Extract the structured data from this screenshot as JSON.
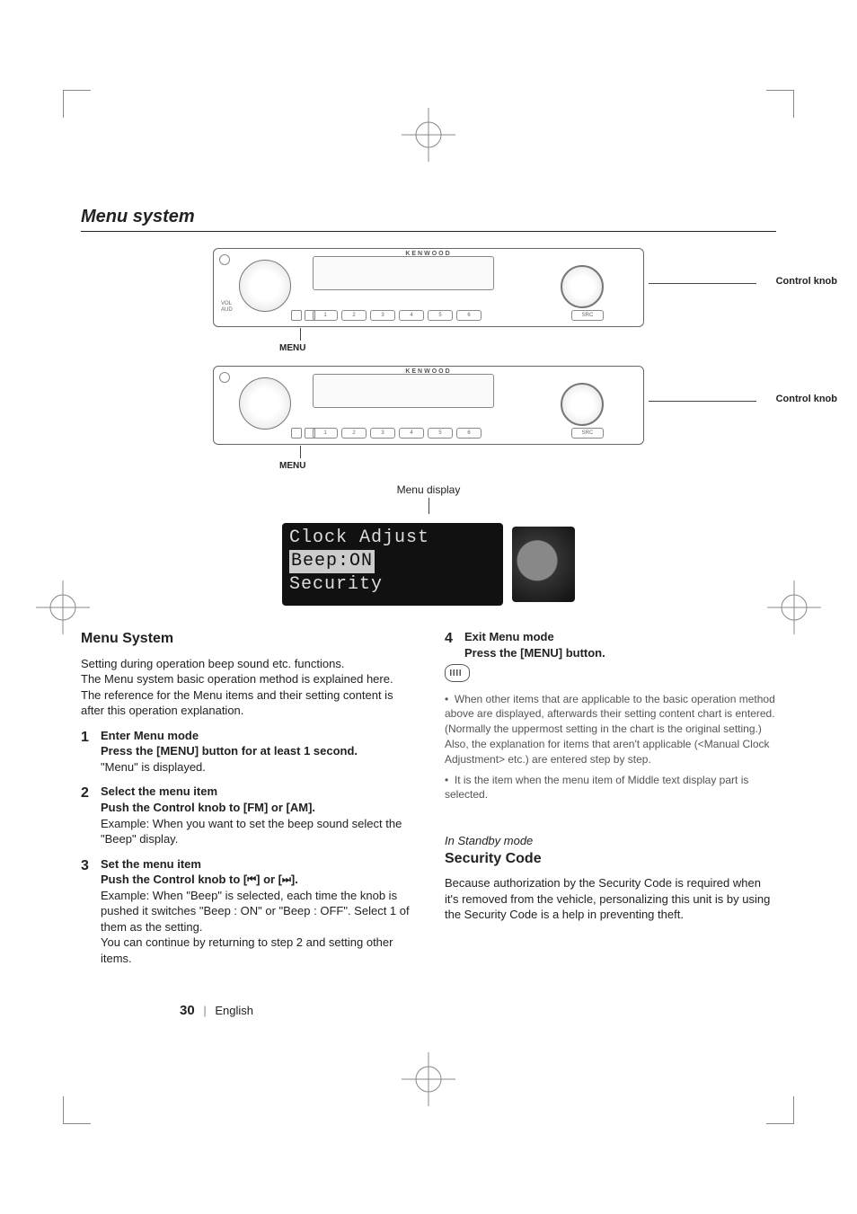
{
  "page": {
    "section_title": "Menu system",
    "page_number": "30",
    "language": "English"
  },
  "diagram": {
    "brand": "KENWOOD",
    "control_knob_label": "Control knob",
    "menu_label": "MENU",
    "menu_display_caption": "Menu display",
    "src_label": "SRC",
    "vol_label_1": "VOL",
    "vol_label_2": "AUD",
    "num_buttons": [
      "1",
      "2",
      "3",
      "4",
      "5",
      "6"
    ],
    "lcd_lines": {
      "line1": "Clock Adjust",
      "line2": "Beep:ON",
      "line3": "Security"
    }
  },
  "left": {
    "heading": "Menu System",
    "intro1": "Setting during operation beep sound etc. functions.",
    "intro2": "The Menu system basic operation method is explained here. The reference for the Menu items and their setting content is after this operation explanation.",
    "steps": [
      {
        "num": "1",
        "title": "Enter Menu mode",
        "instr": "Press the [MENU] button for at least 1 second.",
        "body": "\"Menu\" is displayed."
      },
      {
        "num": "2",
        "title": "Select the menu item",
        "instr": "Push the Control knob to [FM] or [AM].",
        "body": "Example: When you want to set the beep sound select the \"Beep\" display."
      },
      {
        "num": "3",
        "title": "Set the menu item",
        "instr_pre": "Push the Control knob to [",
        "instr_mid": "] or [",
        "instr_post": "].",
        "body": "Example: When \"Beep\" is selected, each time the knob is pushed it switches \"Beep : ON\" or \"Beep : OFF\". Select 1 of them as the setting.",
        "tail": "You can continue by returning to step 2 and setting other items."
      }
    ]
  },
  "right": {
    "step4": {
      "num": "4",
      "title": "Exit Menu mode",
      "instr": "Press the [MENU] button."
    },
    "notes": [
      "When other items that are applicable to the basic operation method above are displayed, afterwards their setting content chart is entered. (Normally the uppermost setting in the chart is the original setting.) Also, the explanation for items that aren't applicable (<Manual Clock Adjustment> etc.) are entered step by step.",
      "It is the item when the menu item of Middle text display part is selected."
    ],
    "mode_label": "In Standby mode",
    "heading2": "Security Code",
    "sec_body": "Because authorization by the Security Code is required when it's removed from the vehicle, personalizing this unit is by using the Security Code is a help in preventing theft."
  }
}
